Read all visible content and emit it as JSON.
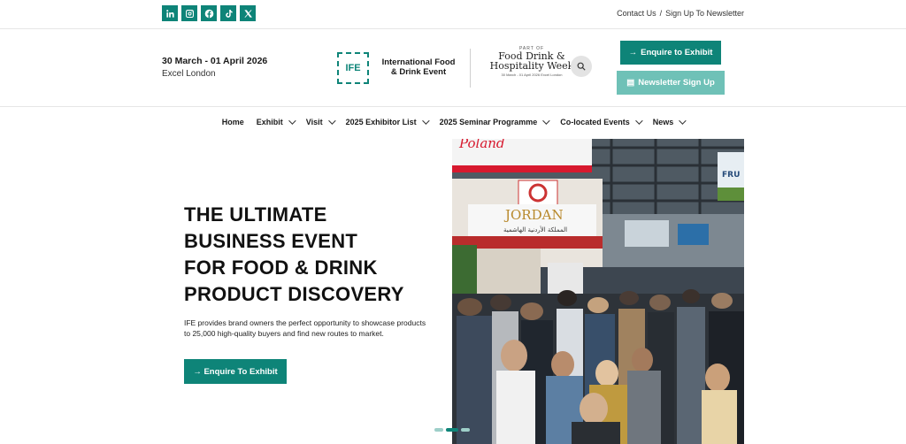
{
  "topbar": {
    "socials": [
      {
        "icon": "linkedin-icon",
        "label": "in"
      },
      {
        "icon": "instagram-icon",
        "label": ""
      },
      {
        "icon": "facebook-icon",
        "label": "f"
      },
      {
        "icon": "tiktok-icon",
        "label": "♪"
      },
      {
        "icon": "x-icon",
        "label": "X"
      }
    ],
    "contact_label": "Contact Us",
    "separator": "/",
    "newsletter_label": "Sign Up To Newsletter"
  },
  "header": {
    "date": "30 March - 01 April 2026",
    "venue": "Excel London",
    "ife_badge": "IFE",
    "ife_name_line1": "International Food",
    "ife_name_line2": "& Drink Event",
    "fdh_part_of": "PART OF",
    "fdh_line1": "Food Drink &",
    "fdh_line2": "Hospitality Week",
    "fdh_tiny": "30 March - 01 April 2026 Excel London",
    "enquire_label": "Enquire to Exhibit",
    "newsletter_label": "Newsletter Sign Up"
  },
  "nav": {
    "items": [
      {
        "label": "Home",
        "dropdown": false
      },
      {
        "label": "Exhibit",
        "dropdown": true
      },
      {
        "label": "Visit",
        "dropdown": true
      },
      {
        "label": "2025 Exhibitor List",
        "dropdown": true
      },
      {
        "label": "2025 Seminar Programme",
        "dropdown": true
      },
      {
        "label": "Co-located Events",
        "dropdown": true
      },
      {
        "label": "News",
        "dropdown": true
      }
    ]
  },
  "hero": {
    "title_lines": [
      "THE ULTIMATE",
      "BUSINESS EVENT",
      "FOR FOOD & DRINK",
      "PRODUCT DISCOVERY"
    ],
    "body": "IFE provides brand owners the perfect opportunity to showcase products to 25,000 high-quality buyers and find new routes to market.",
    "cta_label": "Enquire To Exhibit",
    "photo_sign_1": "Poland",
    "photo_sign_2": "JORDAN",
    "photo_sign_2_sub": "المملكة الأردنية الهاشمية",
    "photo_sign_3": "FRU"
  },
  "colors": {
    "brand_teal": "#0e8478",
    "light_teal": "#6fc1b7"
  }
}
